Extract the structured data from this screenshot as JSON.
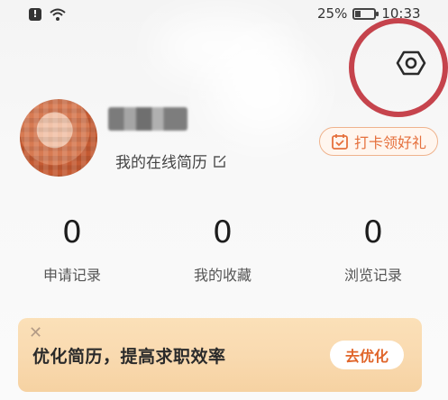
{
  "status_bar": {
    "battery_percent": "25%",
    "battery_level": 0.25,
    "time": "10:33",
    "icons": [
      "alert-icon",
      "wifi-icon",
      "battery-icon"
    ]
  },
  "header": {
    "settings_icon": "hexagon-gear-icon"
  },
  "profile": {
    "online_resume_label": "我的在线简历",
    "edit_icon": "edit-icon",
    "checkin_label": "打卡领好礼",
    "checkin_icon": "calendar-check-icon"
  },
  "stats": [
    {
      "value": "0",
      "label": "申请记录"
    },
    {
      "value": "0",
      "label": "我的收藏"
    },
    {
      "value": "0",
      "label": "浏览记录"
    }
  ],
  "banner": {
    "close_icon": "close-icon",
    "text": "优化简历，提高求职效率",
    "button_label": "去优化"
  },
  "colors": {
    "accent": "#e5703c",
    "highlight_ring": "#c0303a",
    "banner_bg": "#f9dab0"
  }
}
